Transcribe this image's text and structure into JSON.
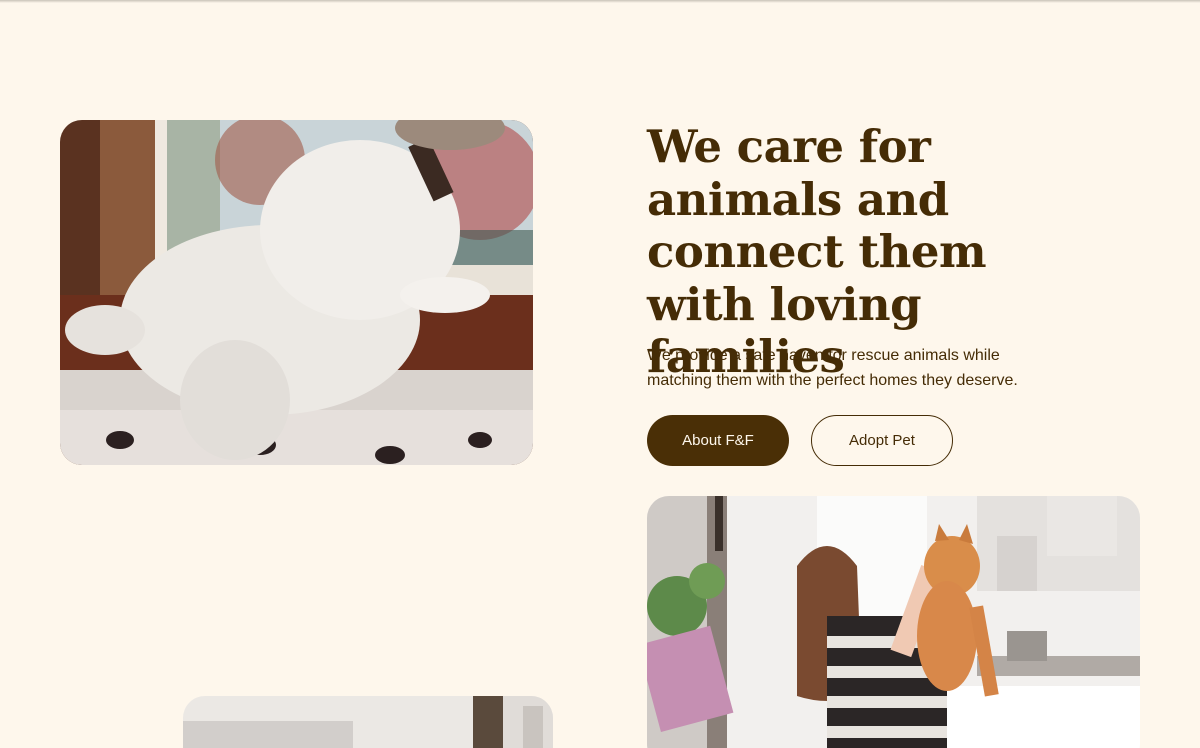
{
  "hero": {
    "title": "We care for animals and connect them with loving families",
    "description": "We provide a safe haven for rescue animals while matching them with the perfect homes they deserve.",
    "buttons": {
      "about_label": "About F&F",
      "adopt_label": "Adopt Pet"
    }
  },
  "images": {
    "dog_photo": "white terrier dog looking out of a window",
    "cat_photo": "woman holding up an orange cat in a kitchen",
    "third_photo": "partially visible photo"
  },
  "colors": {
    "background": "#FEF7EC",
    "text_brown": "#452C06",
    "button_fill": "#4A2F06"
  }
}
